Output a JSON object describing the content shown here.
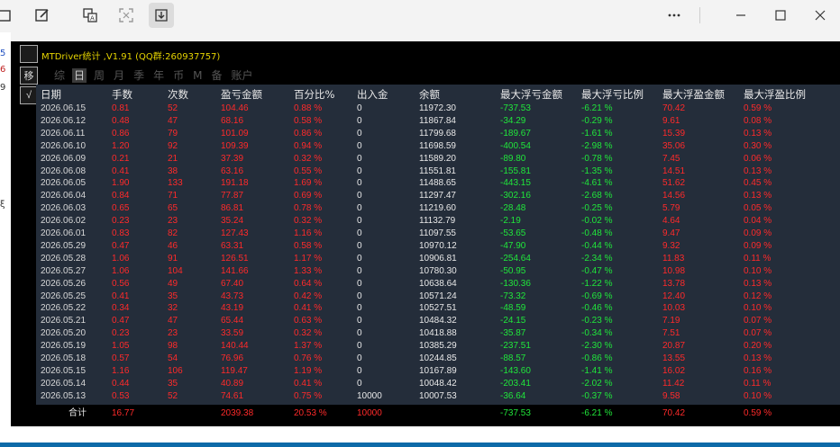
{
  "toolbar": {
    "icons": [
      "window-icon",
      "edit-icon",
      "translate-icon",
      "scan-icon",
      "download-icon",
      "more-icon",
      "minimize-icon",
      "maximize-icon",
      "close-icon"
    ]
  },
  "left_strip": {
    "glyphs": [
      "5",
      "6",
      "9",
      "ξ"
    ]
  },
  "panel": {
    "side_icons": [
      "",
      "移",
      "√"
    ],
    "title": "MTDriver统计 ,V1.91 (QQ群:260937757)",
    "tabs": [
      "综",
      "日",
      "周",
      "月",
      "季",
      "年",
      "币",
      "M",
      "备",
      "账户"
    ],
    "active_tab": "日"
  },
  "table": {
    "columns": [
      "日期",
      "手数",
      "次数",
      "盈亏金额",
      "百分比%",
      "出入金",
      "余额",
      "最大浮亏金额",
      "最大浮亏比例",
      "最大浮盈金额",
      "最大浮盈比例"
    ],
    "rows": [
      [
        "2026.06.15",
        "0.81",
        "52",
        "104.46",
        "0.88 %",
        "0",
        "11972.30",
        "-737.53",
        "-6.21 %",
        "70.42",
        "0.59 %"
      ],
      [
        "2026.06.12",
        "0.48",
        "47",
        "68.16",
        "0.58 %",
        "0",
        "11867.84",
        "-34.29",
        "-0.29 %",
        "9.61",
        "0.08 %"
      ],
      [
        "2026.06.11",
        "0.86",
        "79",
        "101.09",
        "0.86 %",
        "0",
        "11799.68",
        "-189.67",
        "-1.61 %",
        "15.39",
        "0.13 %"
      ],
      [
        "2026.06.10",
        "1.20",
        "92",
        "109.39",
        "0.94 %",
        "0",
        "11698.59",
        "-400.54",
        "-2.98 %",
        "35.06",
        "0.30 %"
      ],
      [
        "2026.06.09",
        "0.21",
        "21",
        "37.39",
        "0.32 %",
        "0",
        "11589.20",
        "-89.80",
        "-0.78 %",
        "7.45",
        "0.06 %"
      ],
      [
        "2026.06.08",
        "0.41",
        "38",
        "63.16",
        "0.55 %",
        "0",
        "11551.81",
        "-155.81",
        "-1.35 %",
        "14.51",
        "0.13 %"
      ],
      [
        "2026.06.05",
        "1.90",
        "133",
        "191.18",
        "1.69 %",
        "0",
        "11488.65",
        "-443.15",
        "-4.61 %",
        "51.62",
        "0.45 %"
      ],
      [
        "2026.06.04",
        "0.84",
        "71",
        "77.87",
        "0.69 %",
        "0",
        "11297.47",
        "-302.16",
        "-2.68 %",
        "14.56",
        "0.13 %"
      ],
      [
        "2026.06.03",
        "0.65",
        "65",
        "86.81",
        "0.78 %",
        "0",
        "11219.60",
        "-28.48",
        "-0.25 %",
        "5.79",
        "0.05 %"
      ],
      [
        "2026.06.02",
        "0.23",
        "23",
        "35.24",
        "0.32 %",
        "0",
        "11132.79",
        "-2.19",
        "-0.02 %",
        "4.64",
        "0.04 %"
      ],
      [
        "2026.06.01",
        "0.83",
        "82",
        "127.43",
        "1.16 %",
        "0",
        "11097.55",
        "-53.65",
        "-0.48 %",
        "9.47",
        "0.09 %"
      ],
      [
        "2026.05.29",
        "0.47",
        "46",
        "63.31",
        "0.58 %",
        "0",
        "10970.12",
        "-47.90",
        "-0.44 %",
        "9.32",
        "0.09 %"
      ],
      [
        "2026.05.28",
        "1.06",
        "91",
        "126.51",
        "1.17 %",
        "0",
        "10906.81",
        "-254.64",
        "-2.34 %",
        "11.83",
        "0.11 %"
      ],
      [
        "2026.05.27",
        "1.06",
        "104",
        "141.66",
        "1.33 %",
        "0",
        "10780.30",
        "-50.95",
        "-0.47 %",
        "10.98",
        "0.10 %"
      ],
      [
        "2026.05.26",
        "0.56",
        "49",
        "67.40",
        "0.64 %",
        "0",
        "10638.64",
        "-130.36",
        "-1.22 %",
        "13.78",
        "0.13 %"
      ],
      [
        "2026.05.25",
        "0.41",
        "35",
        "43.73",
        "0.42 %",
        "0",
        "10571.24",
        "-73.32",
        "-0.69 %",
        "12.40",
        "0.12 %"
      ],
      [
        "2026.05.22",
        "0.34",
        "32",
        "43.19",
        "0.41 %",
        "0",
        "10527.51",
        "-48.59",
        "-0.46 %",
        "10.03",
        "0.10 %"
      ],
      [
        "2026.05.21",
        "0.47",
        "47",
        "65.44",
        "0.63 %",
        "0",
        "10484.32",
        "-24.15",
        "-0.23 %",
        "7.19",
        "0.07 %"
      ],
      [
        "2026.05.20",
        "0.23",
        "23",
        "33.59",
        "0.32 %",
        "0",
        "10418.88",
        "-35.87",
        "-0.34 %",
        "7.51",
        "0.07 %"
      ],
      [
        "2026.05.19",
        "1.05",
        "98",
        "140.44",
        "1.37 %",
        "0",
        "10385.29",
        "-237.51",
        "-2.30 %",
        "20.87",
        "0.20 %"
      ],
      [
        "2026.05.18",
        "0.57",
        "54",
        "76.96",
        "0.76 %",
        "0",
        "10244.85",
        "-88.57",
        "-0.86 %",
        "13.55",
        "0.13 %"
      ],
      [
        "2026.05.15",
        "1.16",
        "106",
        "119.47",
        "1.19 %",
        "0",
        "10167.89",
        "-143.60",
        "-1.41 %",
        "16.02",
        "0.16 %"
      ],
      [
        "2026.05.14",
        "0.44",
        "35",
        "40.89",
        "0.41 %",
        "0",
        "10048.42",
        "-203.41",
        "-2.02 %",
        "11.42",
        "0.11 %"
      ],
      [
        "2026.05.13",
        "0.53",
        "52",
        "74.61",
        "0.75 %",
        "10000",
        "10007.53",
        "-36.64",
        "-0.37 %",
        "9.58",
        "0.10 %"
      ]
    ],
    "total": [
      "合计",
      "16.77",
      "",
      "2039.38",
      "20.53 %",
      "10000",
      "",
      "-737.53",
      "-6.21 %",
      "70.42",
      "0.59 %"
    ]
  },
  "colors": {
    "red": "#ff2a2a",
    "green": "#20e63a",
    "title": "#e6d400",
    "grid_bg": "#242d3a"
  }
}
